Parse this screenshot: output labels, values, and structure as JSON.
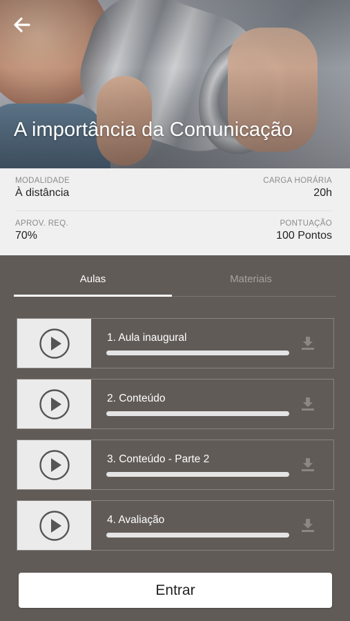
{
  "header": {
    "title": "A importância da Comunicação",
    "back_icon": "arrow-left-icon"
  },
  "info": {
    "modalidade_label": "MODALIDADE",
    "modalidade_value": "À distância",
    "carga_label": "CARGA HORÁRIA",
    "carga_value": "20h",
    "aprov_label": "APROV. REQ.",
    "aprov_value": "70%",
    "pontuacao_label": "PONTUAÇÃO",
    "pontuacao_value": "100 Pontos"
  },
  "tabs": [
    {
      "label": "Aulas",
      "active": true
    },
    {
      "label": "Materiais",
      "active": false
    }
  ],
  "lessons": [
    {
      "title": "1. Aula inaugural",
      "progress": 0
    },
    {
      "title": "2. Conteúdo",
      "progress": 0
    },
    {
      "title": "3. Conteúdo - Parte 2",
      "progress": 0
    },
    {
      "title": "4. Avaliação",
      "progress": 0
    }
  ],
  "enter_label": "Entrar",
  "colors": {
    "background": "#615b57",
    "info_panel": "#f0f0f0",
    "active_tab": "#ffffff",
    "inactive_tab": "#a8a29e"
  }
}
